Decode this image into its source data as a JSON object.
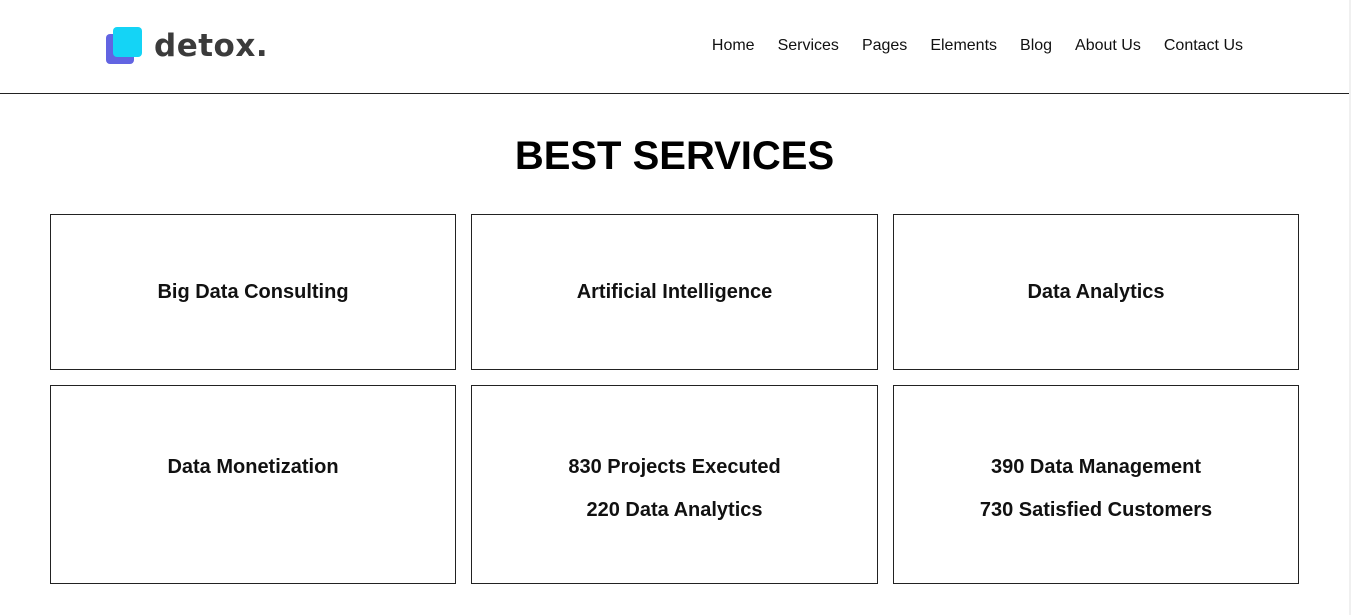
{
  "header": {
    "logo_text": "detox.",
    "logo_icon": "stacked-squares-logo",
    "nav": [
      {
        "label": "Home"
      },
      {
        "label": "Services"
      },
      {
        "label": "Pages"
      },
      {
        "label": "Elements"
      },
      {
        "label": "Blog"
      },
      {
        "label": "About Us"
      },
      {
        "label": "Contact Us"
      }
    ]
  },
  "main": {
    "title": "BEST SERVICES",
    "cards": [
      {
        "lines": [
          "Big Data Consulting"
        ]
      },
      {
        "lines": [
          "Artificial Intelligence"
        ]
      },
      {
        "lines": [
          "Data Analytics"
        ]
      },
      {
        "lines": [
          "Data Monetization"
        ]
      },
      {
        "lines": [
          "830 Projects Executed",
          "220 Data Analytics"
        ]
      },
      {
        "lines": [
          "390 Data Management",
          "730 Satisfied Customers"
        ]
      }
    ]
  },
  "colors": {
    "logo_front": "#14d4f6",
    "logo_back": "#6264e2",
    "logo_text": "#3b3b3b",
    "border": "#222222"
  }
}
